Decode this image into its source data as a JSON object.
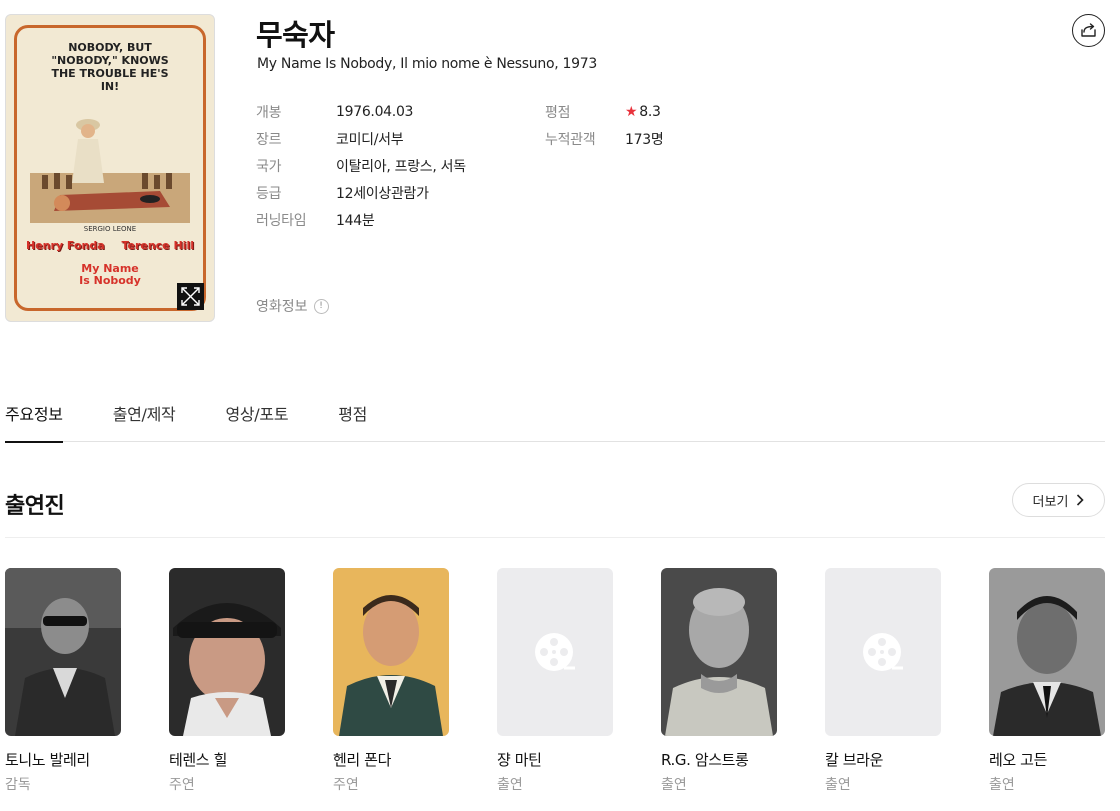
{
  "poster": {
    "tagline": "NOBODY, BUT \"NOBODY,\" KNOWS THE TROUBLE HE'S IN!",
    "credit": "SERGIO LEONE",
    "name_left": "Henry Fonda",
    "name_right": "Terence Hill",
    "poster_title": "My Name Is Nobody"
  },
  "movie": {
    "title": "무숙자",
    "subtitle": "My Name Is Nobody, Il mio nome è Nessuno, 1973"
  },
  "meta_left": [
    {
      "key": "개봉",
      "value": "1976.04.03"
    },
    {
      "key": "장르",
      "value": "코미디/서부"
    },
    {
      "key": "국가",
      "value": "이탈리아, 프랑스, 서독"
    },
    {
      "key": "등급",
      "value": "12세이상관람가"
    },
    {
      "key": "러닝타임",
      "value": "144분"
    }
  ],
  "meta_right": [
    {
      "key": "평점",
      "value": "8.3",
      "icon": "star-icon"
    },
    {
      "key": "누적관객",
      "value": "173명"
    }
  ],
  "movie_info": {
    "label": "영화정보",
    "badge": "!"
  },
  "tabs": [
    {
      "label": "주요정보",
      "active": true
    },
    {
      "label": "출연/제작",
      "active": false
    },
    {
      "label": "영상/포토",
      "active": false
    },
    {
      "label": "평점",
      "active": false
    }
  ],
  "cast_section": {
    "title": "출연진",
    "more_label": "더보기"
  },
  "cast": [
    {
      "name": "토니노 발레리",
      "role": "감독",
      "photo": "photo"
    },
    {
      "name": "테렌스 힐",
      "role": "주연",
      "photo": "photo"
    },
    {
      "name": "헨리 폰다",
      "role": "주연",
      "photo": "photo"
    },
    {
      "name": "쟝 마틴",
      "role": "출연",
      "photo": "placeholder"
    },
    {
      "name": "R.G. 암스트롱",
      "role": "출연",
      "photo": "photo"
    },
    {
      "name": "칼 브라운",
      "role": "출연",
      "photo": "placeholder"
    },
    {
      "name": "레오 고든",
      "role": "출연",
      "photo": "photo"
    }
  ],
  "colors": {
    "rating_star": "#e8323c",
    "accent": "#111111"
  }
}
